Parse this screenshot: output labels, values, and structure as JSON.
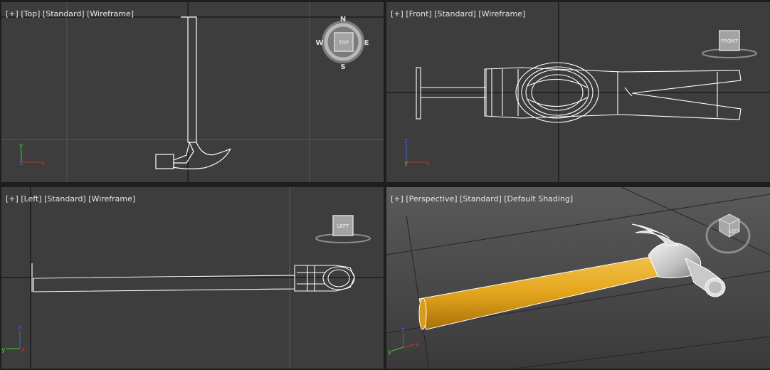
{
  "viewports": {
    "top": {
      "plus": "[+]",
      "view": "[Top]",
      "mode": "[Standard]",
      "shading": "[Wireframe]"
    },
    "front": {
      "plus": "[+]",
      "view": "[Front]",
      "mode": "[Standard]",
      "shading": "[Wireframe]"
    },
    "left": {
      "plus": "[+]",
      "view": "[Left]",
      "mode": "[Standard]",
      "shading": "[Wireframe]"
    },
    "perspective": {
      "plus": "[+]",
      "view": "[Perspective]",
      "mode": "[Standard]",
      "shading": "[Default Shading]"
    }
  },
  "compass": {
    "n": "N",
    "s": "S",
    "e": "E",
    "w": "W"
  },
  "viewcube": {
    "top": "TOP",
    "front": "FRONT",
    "left": "LEFT"
  },
  "axes": {
    "x": "x",
    "y": "y",
    "z": "z"
  },
  "colors": {
    "viewport_bg": "#3d3d3d",
    "wire": "#ffffff",
    "handle": "#e4a51c",
    "active_border": "#8a7a4c"
  }
}
